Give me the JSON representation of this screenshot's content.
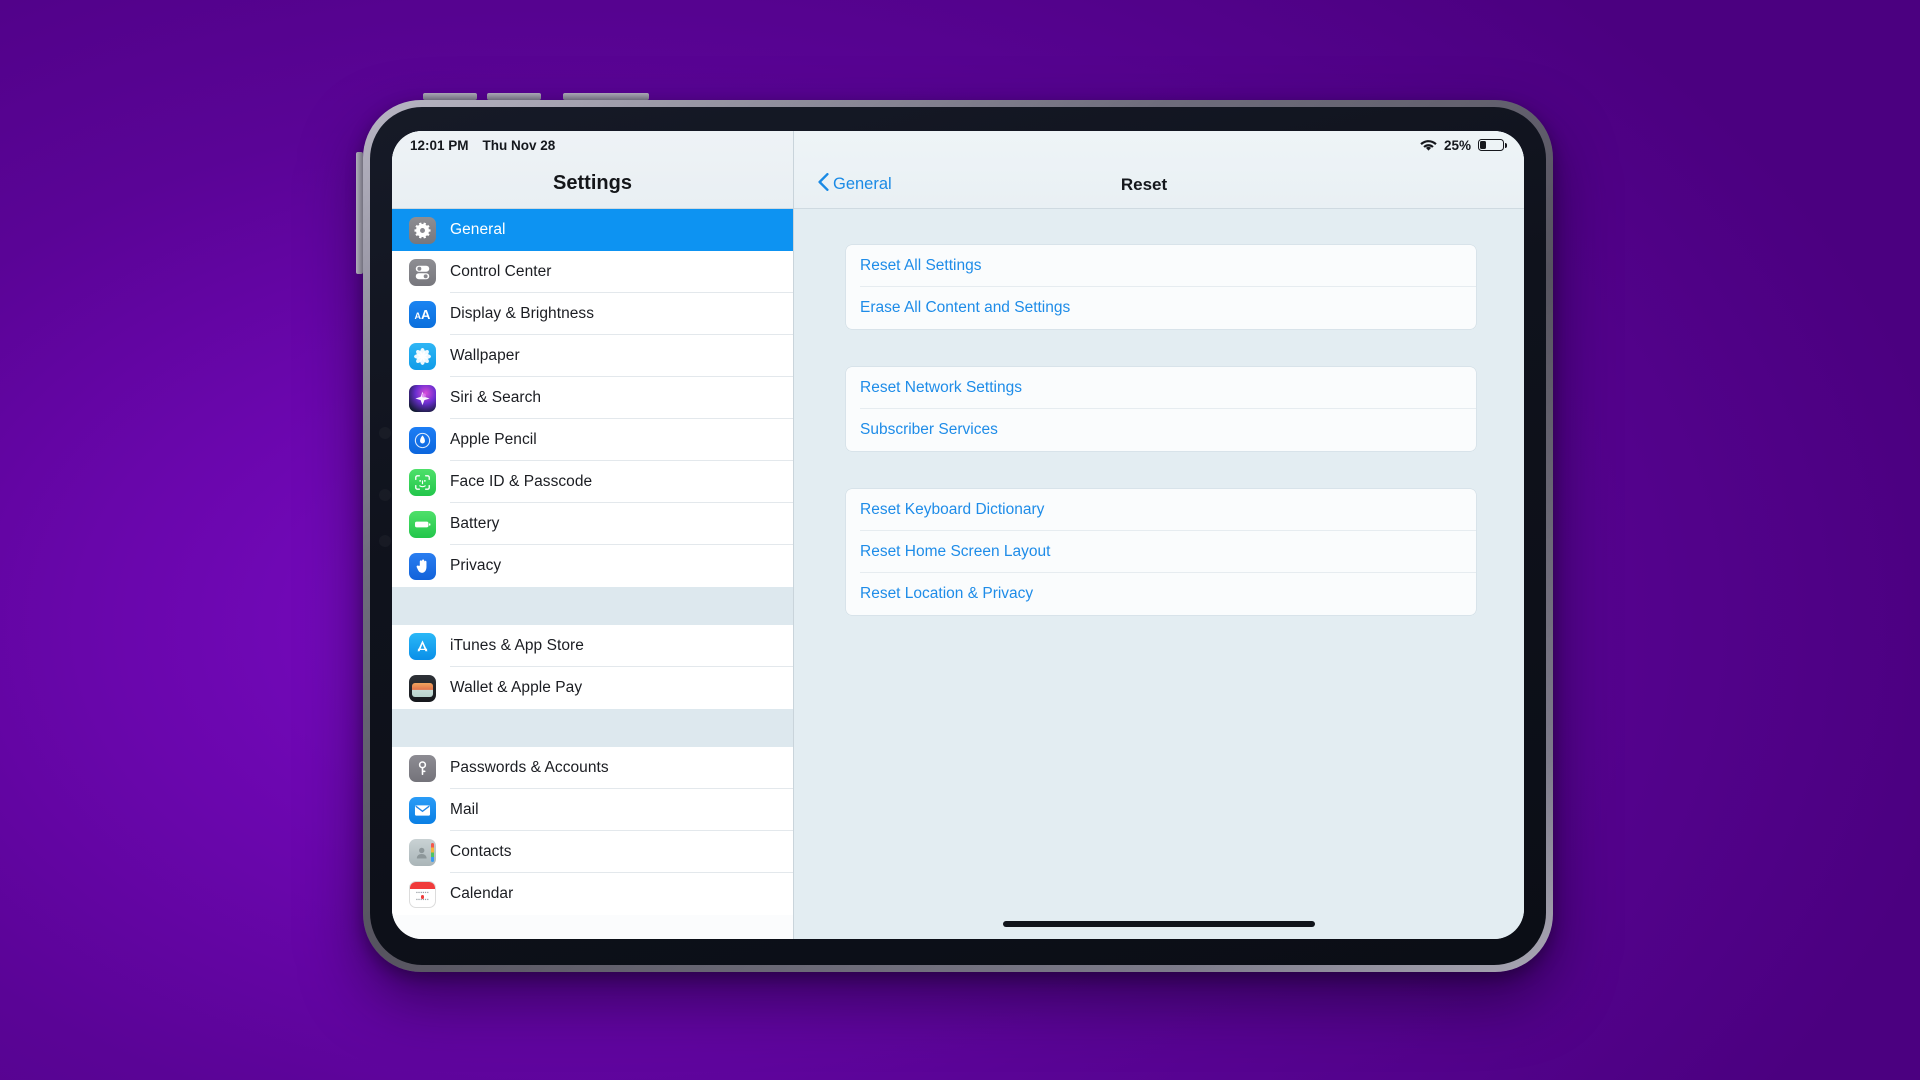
{
  "status_bar": {
    "time": "12:01 PM",
    "date": "Thu Nov 28",
    "wifi_icon": "wifi-icon",
    "battery_percent": "25%",
    "battery_icon": "battery-icon",
    "battery_level": 25
  },
  "sidebar": {
    "title": "Settings",
    "groups": [
      {
        "items": [
          {
            "label": "General",
            "icon": "gear-icon",
            "icon_class": "ic-general",
            "selected": true
          },
          {
            "label": "Control Center",
            "icon": "toggles-icon",
            "icon_class": "ic-control",
            "selected": false
          },
          {
            "label": "Display & Brightness",
            "icon": "letter-aa-icon",
            "icon_class": "ic-display",
            "selected": false
          },
          {
            "label": "Wallpaper",
            "icon": "flower-icon",
            "icon_class": "ic-wallpaper",
            "selected": false
          },
          {
            "label": "Siri & Search",
            "icon": "siri-orb-icon",
            "icon_class": "ic-siri",
            "selected": false
          },
          {
            "label": "Apple Pencil",
            "icon": "pencil-tip-icon",
            "icon_class": "ic-pencil",
            "selected": false
          },
          {
            "label": "Face ID & Passcode",
            "icon": "face-id-icon",
            "icon_class": "ic-faceid",
            "selected": false
          },
          {
            "label": "Battery",
            "icon": "battery-icon",
            "icon_class": "ic-battery",
            "selected": false
          },
          {
            "label": "Privacy",
            "icon": "raised-hand-icon",
            "icon_class": "ic-privacy",
            "selected": false
          }
        ]
      },
      {
        "items": [
          {
            "label": "iTunes & App Store",
            "icon": "app-store-icon",
            "icon_class": "ic-itunes",
            "selected": false
          },
          {
            "label": "Wallet & Apple Pay",
            "icon": "wallet-icon",
            "icon_class": "ic-wallet",
            "selected": false
          }
        ]
      },
      {
        "items": [
          {
            "label": "Passwords & Accounts",
            "icon": "key-icon",
            "icon_class": "ic-passwords",
            "selected": false
          },
          {
            "label": "Mail",
            "icon": "envelope-icon",
            "icon_class": "ic-mail",
            "selected": false
          },
          {
            "label": "Contacts",
            "icon": "contacts-book-icon",
            "icon_class": "ic-contacts",
            "selected": false
          },
          {
            "label": "Calendar",
            "icon": "calendar-icon",
            "icon_class": "ic-calendar",
            "selected": false
          }
        ]
      }
    ]
  },
  "detail": {
    "back_label": "General",
    "back_icon": "chevron-left-icon",
    "title": "Reset",
    "groups": [
      {
        "items": [
          {
            "label": "Reset All Settings"
          },
          {
            "label": "Erase All Content and Settings"
          }
        ]
      },
      {
        "items": [
          {
            "label": "Reset Network Settings"
          },
          {
            "label": "Subscriber Services"
          }
        ]
      },
      {
        "items": [
          {
            "label": "Reset Keyboard Dictionary"
          },
          {
            "label": "Reset Home Screen Layout"
          },
          {
            "label": "Reset Location & Privacy"
          }
        ]
      }
    ]
  },
  "colors": {
    "accent_blue": "#0d93f2",
    "link_blue": "#1e8ce8",
    "detail_background": "#e3edf2",
    "sidebar_background": "#fbfcfd",
    "wallpaper_purple": "#6a06ad"
  },
  "home_indicator": "home-indicator"
}
